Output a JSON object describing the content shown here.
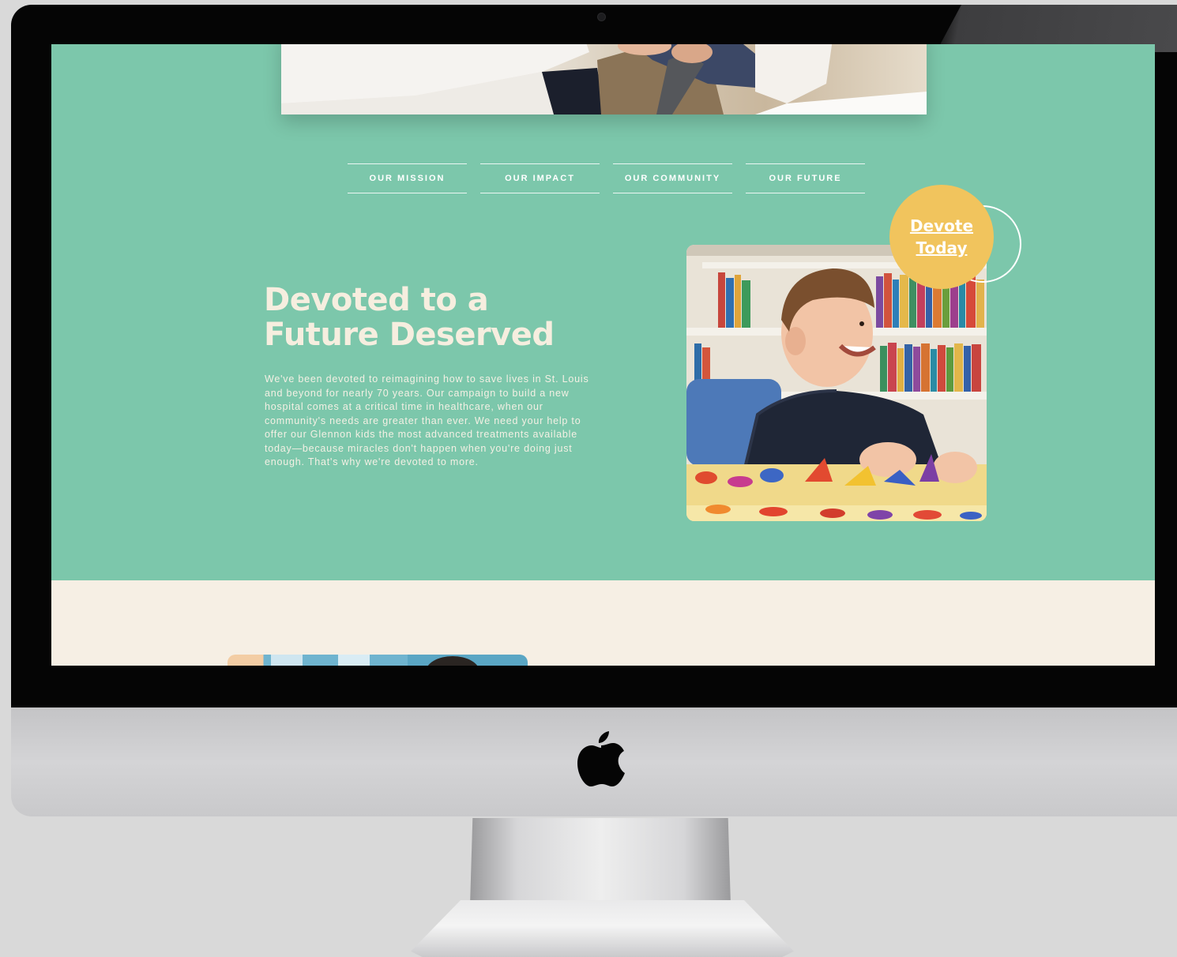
{
  "site": {
    "tabs": [
      {
        "label": "OUR MISSION"
      },
      {
        "label": "OUR IMPACT"
      },
      {
        "label": "OUR COMMUNITY"
      },
      {
        "label": "OUR FUTURE"
      }
    ],
    "headline": {
      "line1": "Devoted to a",
      "line2": "Future Deserved"
    },
    "body_paragraph": "We've been devoted to reimagining how to save lives in St. Louis and beyond for nearly 70 years. Our campaign to build a new hospital comes at a critical time in healthcare, when our community's needs are greater than ever. We need your help to offer our Glennon kids the most advanced treatments available today—because miracles don't happen when you're doing just enough. That's why we're devoted to more.",
    "cta": {
      "line1": "Devote",
      "line2": "Today"
    }
  },
  "colors": {
    "mint_background": "#7cc7ab",
    "cream_background": "#f6efe4",
    "cta_yellow": "#f1c45d",
    "headline_cream": "#f6eedf"
  },
  "icons": [
    "apple-logo-icon"
  ]
}
